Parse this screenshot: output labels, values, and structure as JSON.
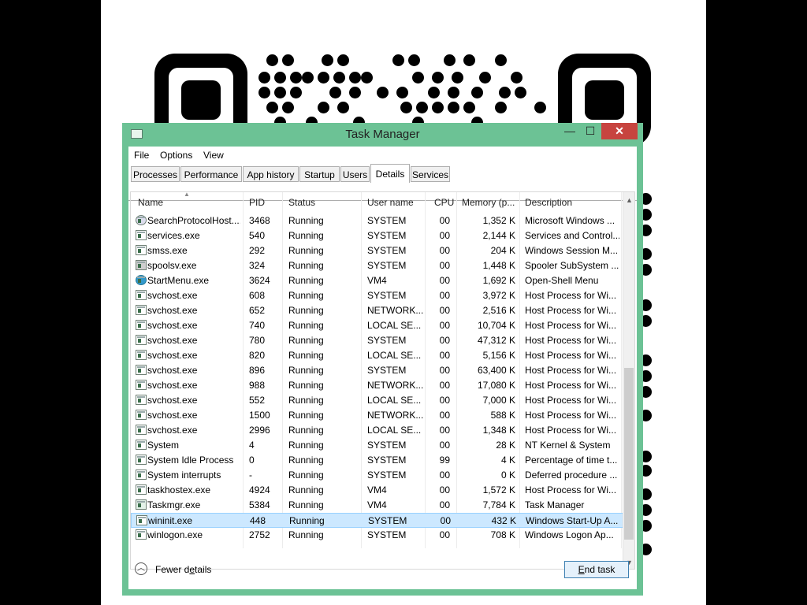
{
  "window": {
    "title": "Task Manager",
    "min_label": "—",
    "max_label": "☐",
    "close_label": "✕"
  },
  "menu": [
    "File",
    "Options",
    "View"
  ],
  "tabs": [
    "Processes",
    "Performance",
    "App history",
    "Startup",
    "Users",
    "Details",
    "Services"
  ],
  "active_tab": "Details",
  "columns": [
    "Name",
    "PID",
    "Status",
    "User name",
    "CPU",
    "Memory (p...",
    "Description"
  ],
  "rows": [
    {
      "icon": "search-icon",
      "name": "SearchProtocolHost....",
      "pid": "3468",
      "status": "Running",
      "user": "SYSTEM",
      "cpu": "00",
      "memory": "1,352 K",
      "description": "Microsoft Windows ..."
    },
    {
      "icon": "window-icon",
      "name": "services.exe",
      "pid": "540",
      "status": "Running",
      "user": "SYSTEM",
      "cpu": "00",
      "memory": "2,144 K",
      "description": "Services and Control..."
    },
    {
      "icon": "window-icon",
      "name": "smss.exe",
      "pid": "292",
      "status": "Running",
      "user": "SYSTEM",
      "cpu": "00",
      "memory": "204 K",
      "description": "Windows Session M..."
    },
    {
      "icon": "printer-icon",
      "name": "spoolsv.exe",
      "pid": "324",
      "status": "Running",
      "user": "SYSTEM",
      "cpu": "00",
      "memory": "1,448 K",
      "description": "Spooler SubSystem ..."
    },
    {
      "icon": "globe-icon",
      "name": "StartMenu.exe",
      "pid": "3624",
      "status": "Running",
      "user": "VM4",
      "cpu": "00",
      "memory": "1,692 K",
      "description": "Open-Shell Menu"
    },
    {
      "icon": "window-icon",
      "name": "svchost.exe",
      "pid": "608",
      "status": "Running",
      "user": "SYSTEM",
      "cpu": "00",
      "memory": "3,972 K",
      "description": "Host Process for Wi..."
    },
    {
      "icon": "window-icon",
      "name": "svchost.exe",
      "pid": "652",
      "status": "Running",
      "user": "NETWORK...",
      "cpu": "00",
      "memory": "2,516 K",
      "description": "Host Process for Wi..."
    },
    {
      "icon": "window-icon",
      "name": "svchost.exe",
      "pid": "740",
      "status": "Running",
      "user": "LOCAL SE...",
      "cpu": "00",
      "memory": "10,704 K",
      "description": "Host Process for Wi..."
    },
    {
      "icon": "window-icon",
      "name": "svchost.exe",
      "pid": "780",
      "status": "Running",
      "user": "SYSTEM",
      "cpu": "00",
      "memory": "47,312 K",
      "description": "Host Process for Wi..."
    },
    {
      "icon": "window-icon",
      "name": "svchost.exe",
      "pid": "820",
      "status": "Running",
      "user": "LOCAL SE...",
      "cpu": "00",
      "memory": "5,156 K",
      "description": "Host Process for Wi..."
    },
    {
      "icon": "window-icon",
      "name": "svchost.exe",
      "pid": "896",
      "status": "Running",
      "user": "SYSTEM",
      "cpu": "00",
      "memory": "63,400 K",
      "description": "Host Process for Wi..."
    },
    {
      "icon": "window-icon",
      "name": "svchost.exe",
      "pid": "988",
      "status": "Running",
      "user": "NETWORK...",
      "cpu": "00",
      "memory": "17,080 K",
      "description": "Host Process for Wi..."
    },
    {
      "icon": "window-icon",
      "name": "svchost.exe",
      "pid": "552",
      "status": "Running",
      "user": "LOCAL SE...",
      "cpu": "00",
      "memory": "7,000 K",
      "description": "Host Process for Wi..."
    },
    {
      "icon": "window-icon",
      "name": "svchost.exe",
      "pid": "1500",
      "status": "Running",
      "user": "NETWORK...",
      "cpu": "00",
      "memory": "588 K",
      "description": "Host Process for Wi..."
    },
    {
      "icon": "window-icon",
      "name": "svchost.exe",
      "pid": "2996",
      "status": "Running",
      "user": "LOCAL SE...",
      "cpu": "00",
      "memory": "1,348 K",
      "description": "Host Process for Wi..."
    },
    {
      "icon": "window-icon",
      "name": "System",
      "pid": "4",
      "status": "Running",
      "user": "SYSTEM",
      "cpu": "00",
      "memory": "28 K",
      "description": "NT Kernel & System"
    },
    {
      "icon": "window-icon",
      "name": "System Idle Process",
      "pid": "0",
      "status": "Running",
      "user": "SYSTEM",
      "cpu": "99",
      "memory": "4 K",
      "description": "Percentage of time t..."
    },
    {
      "icon": "window-icon",
      "name": "System interrupts",
      "pid": "-",
      "status": "Running",
      "user": "SYSTEM",
      "cpu": "00",
      "memory": "0 K",
      "description": "Deferred procedure ..."
    },
    {
      "icon": "window-icon",
      "name": "taskhostex.exe",
      "pid": "4924",
      "status": "Running",
      "user": "VM4",
      "cpu": "00",
      "memory": "1,572 K",
      "description": "Host Process for Wi..."
    },
    {
      "icon": "chart-icon",
      "name": "Taskmgr.exe",
      "pid": "5384",
      "status": "Running",
      "user": "VM4",
      "cpu": "00",
      "memory": "7,784 K",
      "description": "Task Manager"
    },
    {
      "icon": "window-icon",
      "name": "wininit.exe",
      "pid": "448",
      "status": "Running",
      "user": "SYSTEM",
      "cpu": "00",
      "memory": "432 K",
      "description": "Windows Start-Up A...",
      "selected": true
    },
    {
      "icon": "window-icon",
      "name": "winlogon.exe",
      "pid": "2752",
      "status": "Running",
      "user": "SYSTEM",
      "cpu": "00",
      "memory": "708 K",
      "description": "Windows Logon Ap..."
    }
  ],
  "footer": {
    "fewer_details": "Fewer details",
    "end_task": "End task"
  },
  "colors": {
    "window_frame": "#6cc295",
    "close_button": "#c7443f",
    "selection": "#cce8ff"
  }
}
